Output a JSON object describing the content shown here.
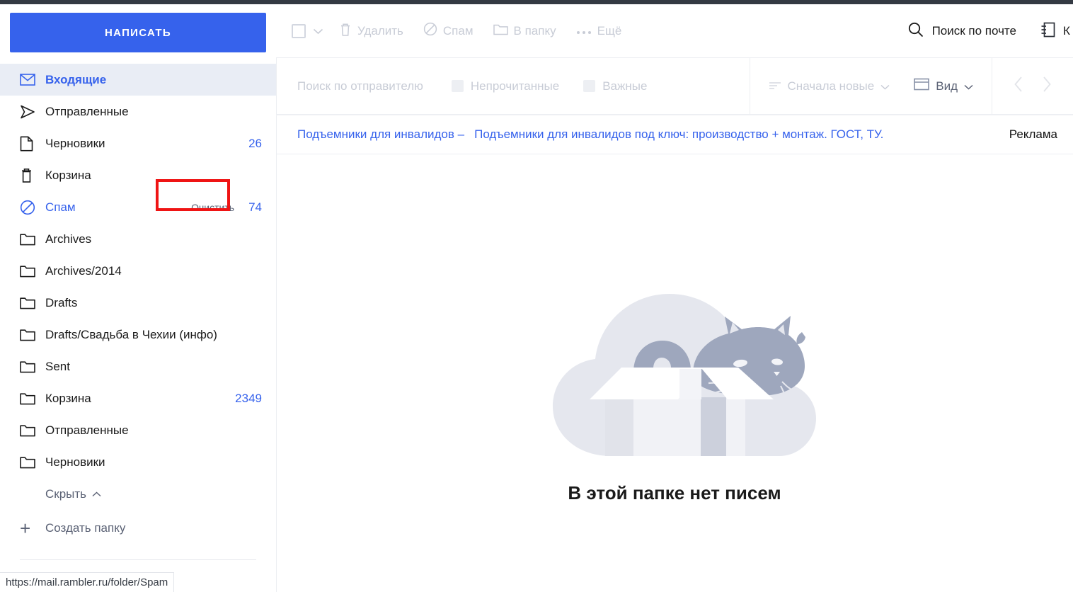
{
  "sidebar": {
    "compose_label": "НАПИСАТЬ",
    "items": [
      {
        "label": "Входящие",
        "icon": "envelope-icon",
        "count": "",
        "active": true,
        "blue": true,
        "action": ""
      },
      {
        "label": "Отправленные",
        "icon": "paper-plane-icon",
        "count": "",
        "active": false,
        "blue": false,
        "action": ""
      },
      {
        "label": "Черновики",
        "icon": "document-icon",
        "count": "26",
        "active": false,
        "blue": false,
        "action": ""
      },
      {
        "label": "Корзина",
        "icon": "trash-icon",
        "count": "",
        "active": false,
        "blue": false,
        "action": ""
      },
      {
        "label": "Спам",
        "icon": "spam-icon",
        "count": "74",
        "active": false,
        "blue": true,
        "action": "Очистить"
      },
      {
        "label": "Archives",
        "icon": "folder-icon",
        "count": "",
        "active": false,
        "blue": false,
        "action": ""
      },
      {
        "label": "Archives/2014",
        "icon": "folder-icon",
        "count": "",
        "active": false,
        "blue": false,
        "action": ""
      },
      {
        "label": "Drafts",
        "icon": "folder-icon",
        "count": "",
        "active": false,
        "blue": false,
        "action": ""
      },
      {
        "label": "Drafts/Свадьба в Чехии (инфо)",
        "icon": "folder-icon",
        "count": "",
        "active": false,
        "blue": false,
        "action": ""
      },
      {
        "label": "Sent",
        "icon": "folder-icon",
        "count": "",
        "active": false,
        "blue": false,
        "action": ""
      },
      {
        "label": "Корзина",
        "icon": "folder-icon",
        "count": "2349",
        "active": false,
        "blue": false,
        "action": ""
      },
      {
        "label": "Отправленные",
        "icon": "folder-icon",
        "count": "",
        "active": false,
        "blue": false,
        "action": ""
      },
      {
        "label": "Черновики",
        "icon": "folder-icon",
        "count": "",
        "active": false,
        "blue": false,
        "action": ""
      }
    ],
    "hide_label": "Скрыть",
    "create_folder_label": "Создать папку",
    "highlight_color": "#ef1414",
    "accent_color": "#3662ec"
  },
  "toolbar": {
    "delete_label": "Удалить",
    "spam_label": "Спам",
    "to_folder_label": "В папку",
    "more_label": "Ещё",
    "search_label": "Поиск по почте",
    "contacts_label": "К"
  },
  "filterbar": {
    "sender_placeholder": "Поиск по отправителю",
    "unread_label": "Непрочитанные",
    "important_label": "Важные",
    "sort_label": "Сначала новые",
    "view_label": "Вид"
  },
  "ad": {
    "title": "Подъемники для инвалидов –",
    "description": "Подъемники для инвалидов под ключ: производство + монтаж. ГОСТ, ТУ.",
    "label": "Реклама"
  },
  "empty_state": {
    "message": "В этой папке нет писем"
  },
  "status_bar": {
    "url": "https://mail.rambler.ru/folder/Spam"
  }
}
